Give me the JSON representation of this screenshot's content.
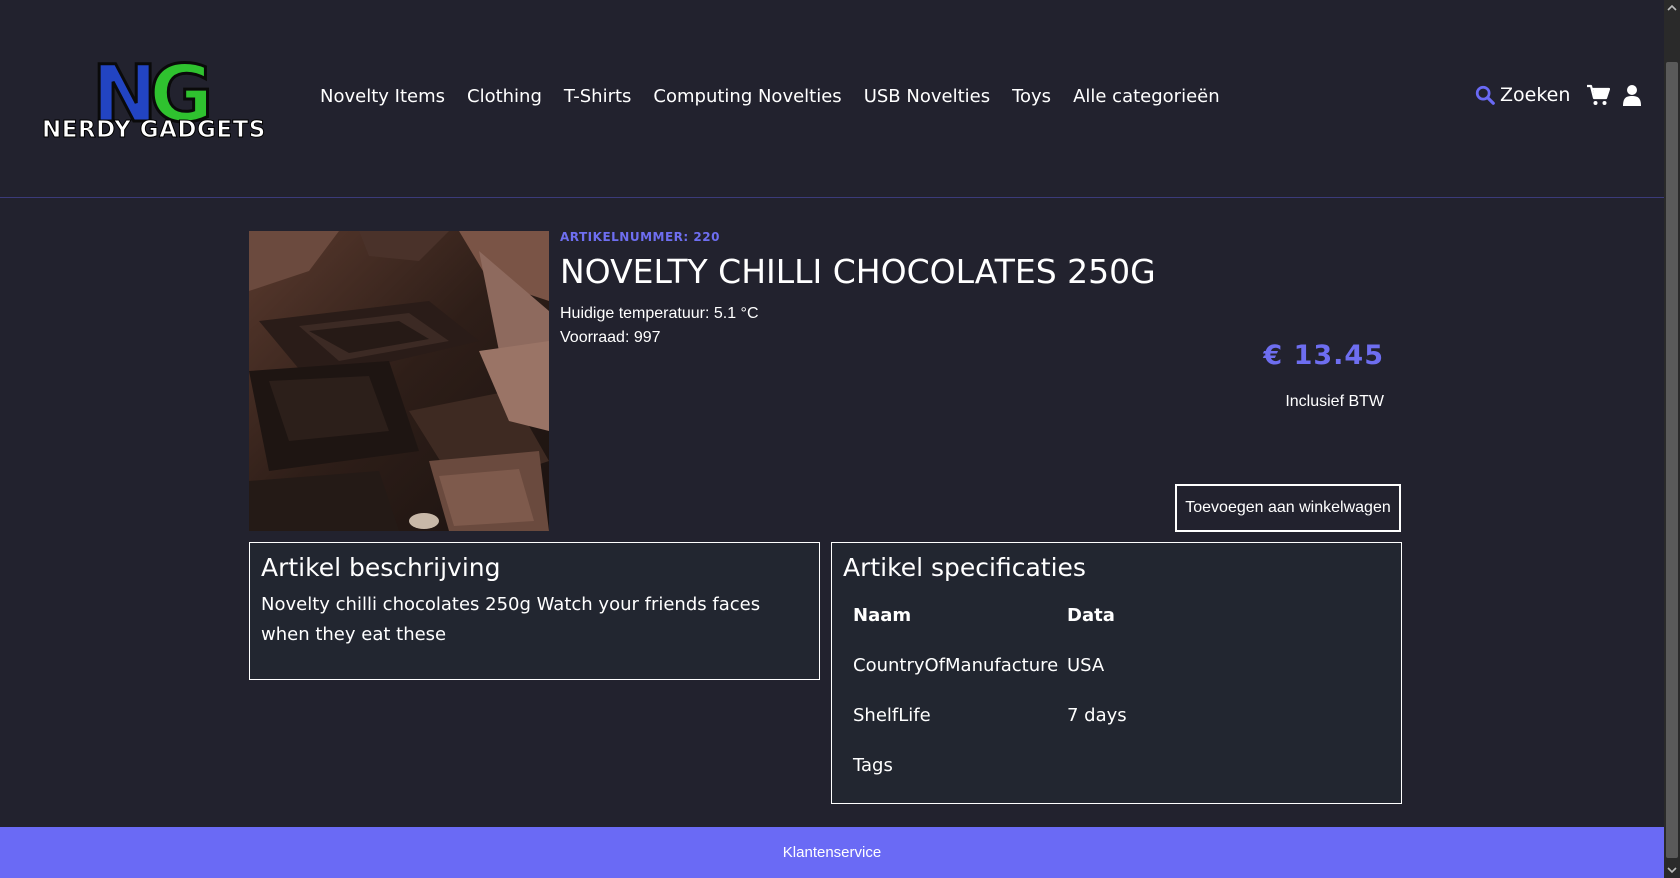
{
  "brand": {
    "logo_letters": "NG",
    "logo_text": "NERDY GADGETS"
  },
  "nav": [
    {
      "label": "Novelty Items"
    },
    {
      "label": "Clothing"
    },
    {
      "label": "T-Shirts"
    },
    {
      "label": "Computing Novelties"
    },
    {
      "label": "USB Novelties"
    },
    {
      "label": "Toys"
    },
    {
      "label": "Alle categorieën"
    }
  ],
  "header": {
    "search_label": "Zoeken"
  },
  "product": {
    "article_number": "ARTIKELNUMMER: 220",
    "title": "NOVELTY CHILLI CHOCOLATES 250G",
    "temperature": "Huidige temperatuur: 5.1 °C",
    "stock": "Voorraad: 997",
    "price": "€ 13.45",
    "vat_note": "Inclusief BTW",
    "add_to_cart": "Toevoegen aan winkelwagen"
  },
  "description": {
    "title": "Artikel beschrijving",
    "text": "Novelty chilli chocolates 250g Watch your friends faces when they eat these"
  },
  "specs": {
    "title": "Artikel specificaties",
    "headers": [
      "Naam",
      "Data"
    ],
    "rows": [
      [
        "CountryOfManufacture",
        "USA"
      ],
      [
        "ShelfLife",
        "7 days"
      ],
      [
        "Tags",
        ""
      ]
    ]
  },
  "footer": {
    "link": "Klantenservice"
  },
  "colors": {
    "accent": "#6a6af5",
    "background": "#22222e"
  }
}
